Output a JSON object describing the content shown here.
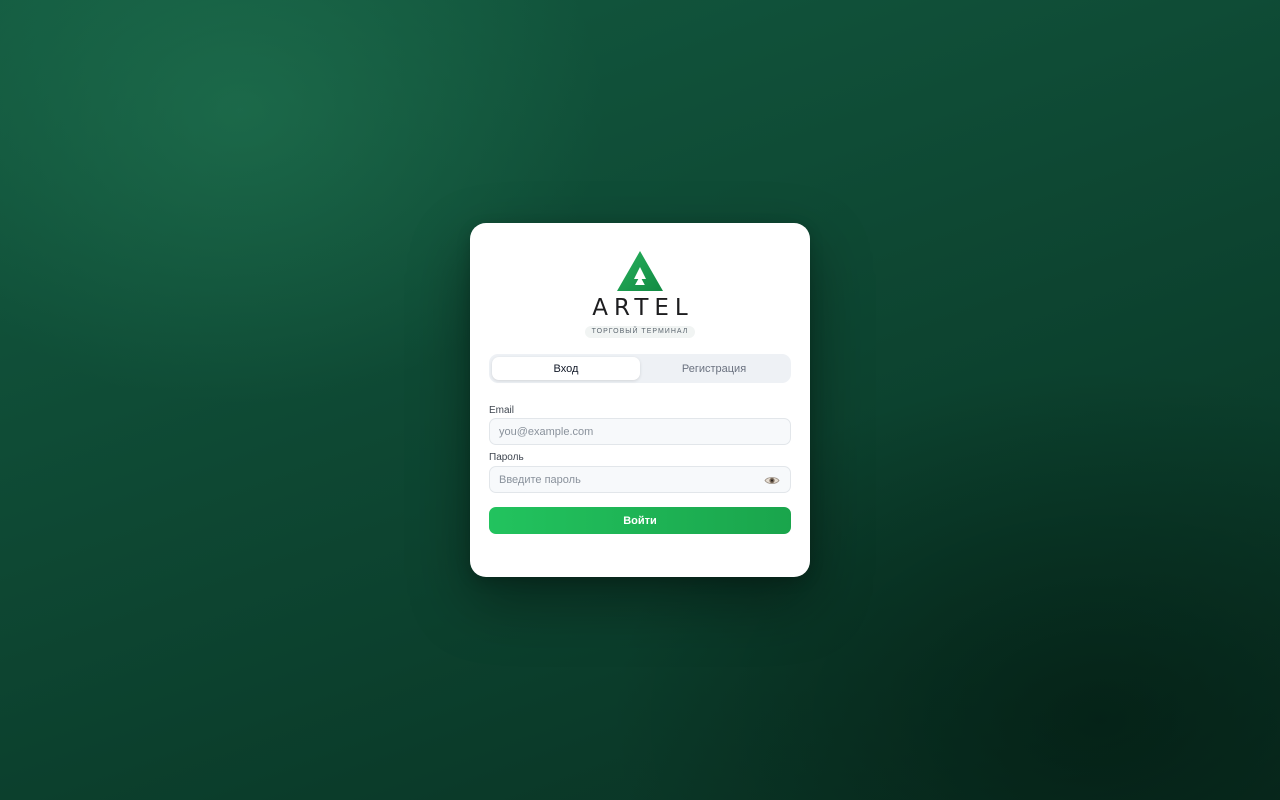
{
  "brand": {
    "name": "ARTEL",
    "subtitle": "ТОРГОВЫЙ ТЕРМИНАЛ",
    "logo_icon": "artel-triangle-logo",
    "accent_color": "#1e9a4c"
  },
  "tabs": [
    {
      "label": "Вход",
      "active": true
    },
    {
      "label": "Регистрация",
      "active": false
    }
  ],
  "form": {
    "email": {
      "label": "Email",
      "value": "",
      "placeholder": "you@example.com"
    },
    "password": {
      "label": "Пароль",
      "value": "",
      "placeholder": "Введите пароль",
      "toggle_icon": "eye-icon"
    },
    "submit_label": "Войти",
    "submit_color": "#22c35e"
  }
}
